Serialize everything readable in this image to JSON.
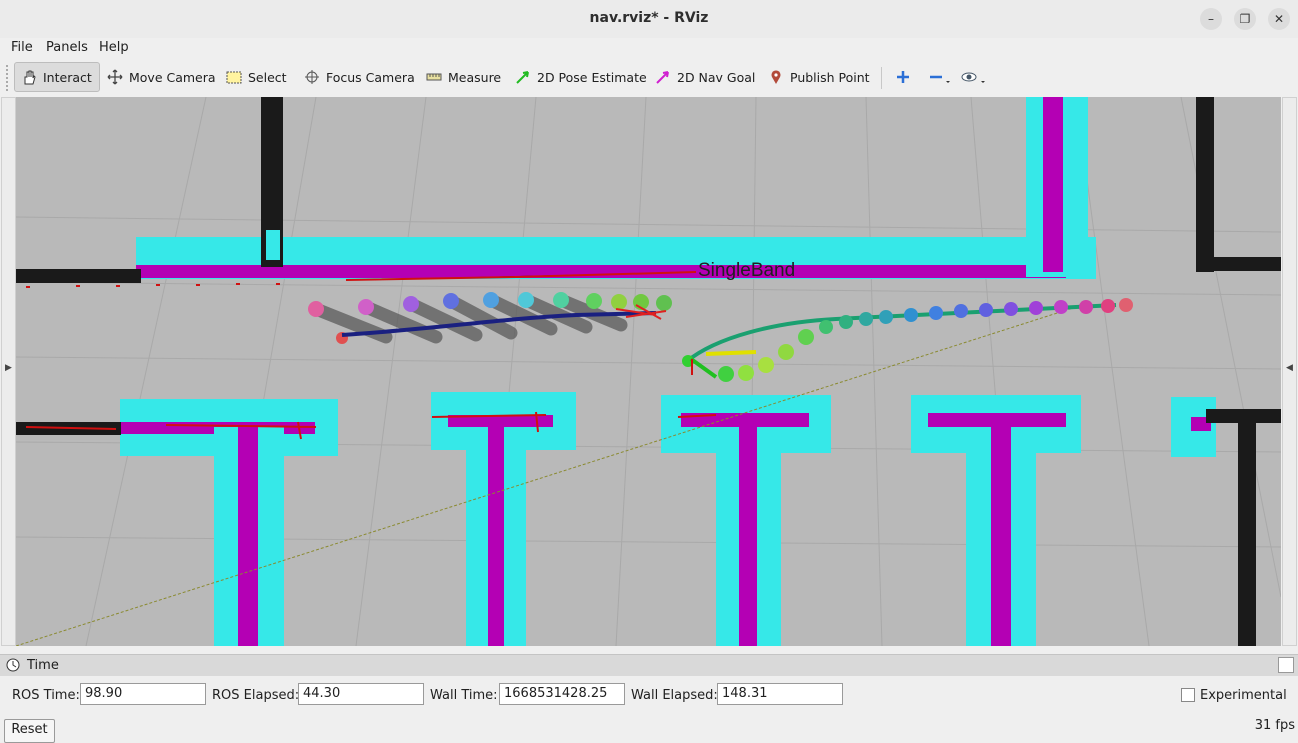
{
  "window": {
    "title": "nav.rviz* - RViz",
    "buttons": [
      "minimize",
      "maximize",
      "close"
    ]
  },
  "menu": [
    {
      "label": "File"
    },
    {
      "label": "Panels"
    },
    {
      "label": "Help"
    }
  ],
  "toolbar": {
    "tools": [
      {
        "label": "Interact",
        "icon": "hand-icon",
        "active": true
      },
      {
        "label": "Move Camera",
        "icon": "move-camera-icon"
      },
      {
        "label": "Select",
        "icon": "select-icon"
      },
      {
        "label": "Focus Camera",
        "icon": "focus-icon"
      },
      {
        "label": "Measure",
        "icon": "ruler-icon"
      },
      {
        "label": "2D Pose Estimate",
        "icon": "green-arrow-icon"
      },
      {
        "label": "2D Nav Goal",
        "icon": "magenta-arrow-icon"
      },
      {
        "label": "Publish Point",
        "icon": "map-pin-icon"
      }
    ],
    "extra_icons": [
      "plus-icon",
      "minus-icon",
      "eye-icon"
    ]
  },
  "viewport": {
    "label_singleband": "SingleBand",
    "colors": {
      "background": "#b9b9b9",
      "wall": "#1a1a1a",
      "inflation": "#36e8e8",
      "obstacle": "#b400b4"
    }
  },
  "time_panel": {
    "title": "Time",
    "ros_time_label": "ROS Time:",
    "ros_time": "98.90",
    "ros_elapsed_label": "ROS Elapsed:",
    "ros_elapsed": "44.30",
    "wall_time_label": "Wall Time:",
    "wall_time": "1668531428.25",
    "wall_elapsed_label": "Wall Elapsed:",
    "wall_elapsed": "148.31",
    "experimental_label": "Experimental",
    "reset_label": "Reset",
    "fps": "31 fps"
  }
}
